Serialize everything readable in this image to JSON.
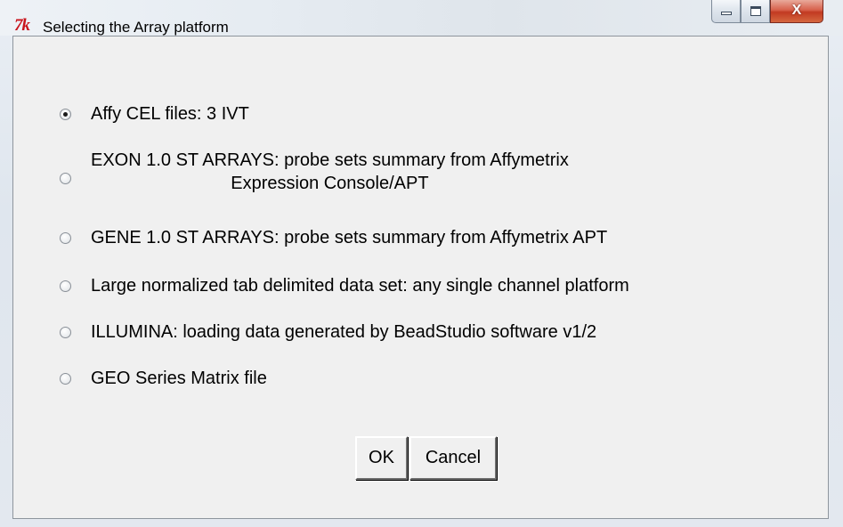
{
  "window": {
    "title": "Selecting the Array platform",
    "app_icon": "7k",
    "caption": {
      "minimize_icon": "minimize-icon",
      "maximize_icon": "maximize-icon",
      "close_glyph": "X"
    }
  },
  "options": [
    {
      "line1": "Affy CEL files: 3 IVT",
      "line2": "",
      "checked": true
    },
    {
      "line1": "EXON 1.0 ST ARRAYS: probe sets summary from Affymetrix",
      "line2": "Expression Console/APT",
      "checked": false
    },
    {
      "line1": "GENE 1.0 ST ARRAYS: probe sets summary from Affymetrix APT",
      "line2": "",
      "checked": false
    },
    {
      "line1": "Large normalized tab delimited data set: any single channel platform",
      "line2": "",
      "checked": false
    },
    {
      "line1": "ILLUMINA: loading data generated by BeadStudio software v1/2",
      "line2": "",
      "checked": false
    },
    {
      "line1": "GEO Series Matrix file",
      "line2": "",
      "checked": false
    }
  ],
  "buttons": {
    "ok": "OK",
    "cancel": "Cancel"
  }
}
